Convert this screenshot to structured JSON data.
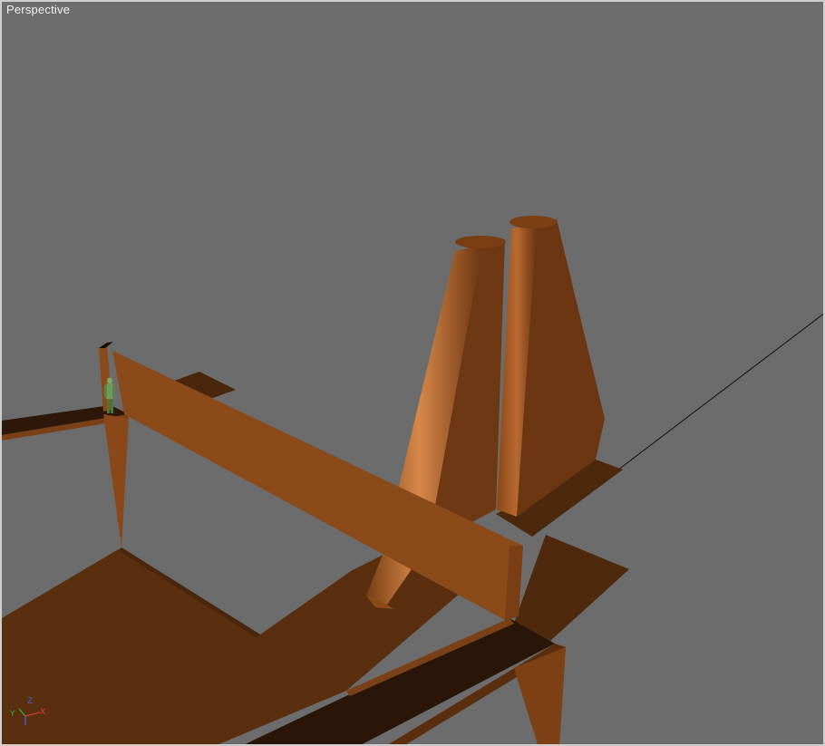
{
  "viewport": {
    "label": "Perspective"
  },
  "axis_gizmo": {
    "x_label": "X",
    "y_label": "Y",
    "z_label": "Z",
    "x_color": "#d43c3c",
    "y_color": "#3cae3c",
    "z_color": "#4a5ed6"
  },
  "colors": {
    "background": "#6c6c6c",
    "border": "#cfcfcf",
    "wood_light": "#8b4a1a",
    "wood_mid": "#6e3812",
    "wood_dark": "#4a260c",
    "wood_shadow": "#2a1609",
    "figure": "#6f9a5c"
  },
  "icons": {
    "character": "soldier-figure-icon",
    "axis": "axis-tripod-icon"
  }
}
